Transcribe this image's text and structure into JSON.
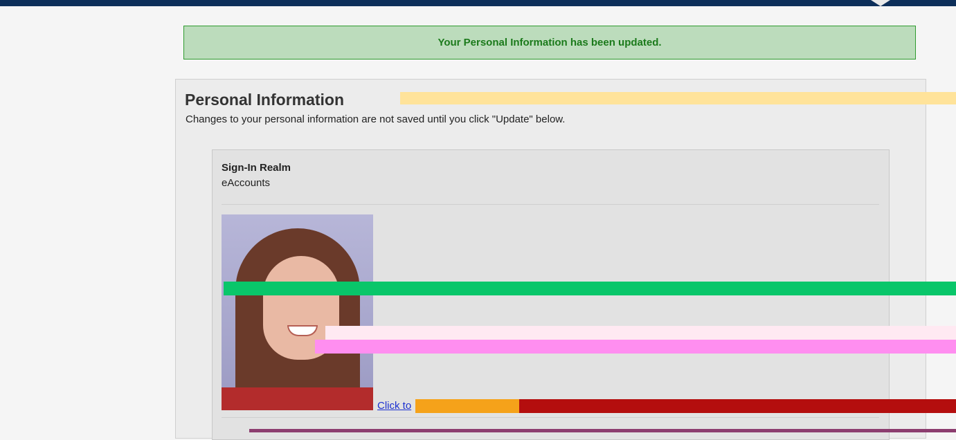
{
  "alert": {
    "message": "Your Personal Information has been updated."
  },
  "page": {
    "heading": "Personal Information",
    "intro": "Changes to your personal information are not saved until you click \"Update\" below."
  },
  "card": {
    "realm_label": "Sign-In Realm",
    "realm_value": "eAccounts",
    "photo_alt": "Profile photo",
    "upload_link": "Click to"
  },
  "colors": {
    "topbar": "#0d2f5a",
    "success_bg": "#bcdcbc",
    "success_text": "#1b7a1b",
    "link": "#1a2fd0"
  }
}
